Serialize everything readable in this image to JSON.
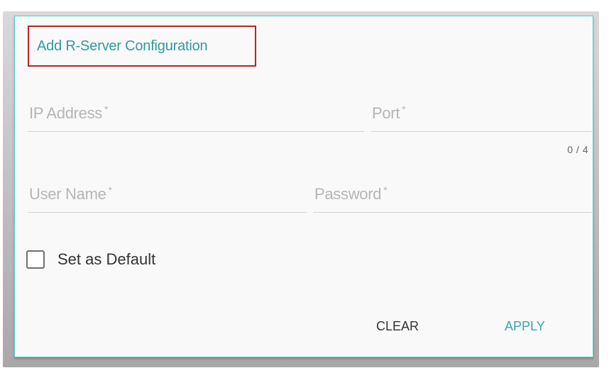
{
  "dialog": {
    "title": "Add R-Server Configuration",
    "fields": {
      "ip_address": {
        "label": "IP Address",
        "required_mark": "*",
        "value": ""
      },
      "port": {
        "label": "Port",
        "required_mark": "*",
        "value": "",
        "counter": "0 / 4"
      },
      "user_name": {
        "label": "User Name",
        "required_mark": "*",
        "value": ""
      },
      "password": {
        "label": "Password",
        "required_mark": "*",
        "value": ""
      }
    },
    "set_default": {
      "label": "Set as Default",
      "checked": false
    },
    "buttons": {
      "clear": "CLEAR",
      "apply": "APPLY"
    }
  },
  "colors": {
    "accent": "#2f9aa0",
    "dialog_border": "#4fd1c5",
    "highlight_box": "#b8242b"
  }
}
